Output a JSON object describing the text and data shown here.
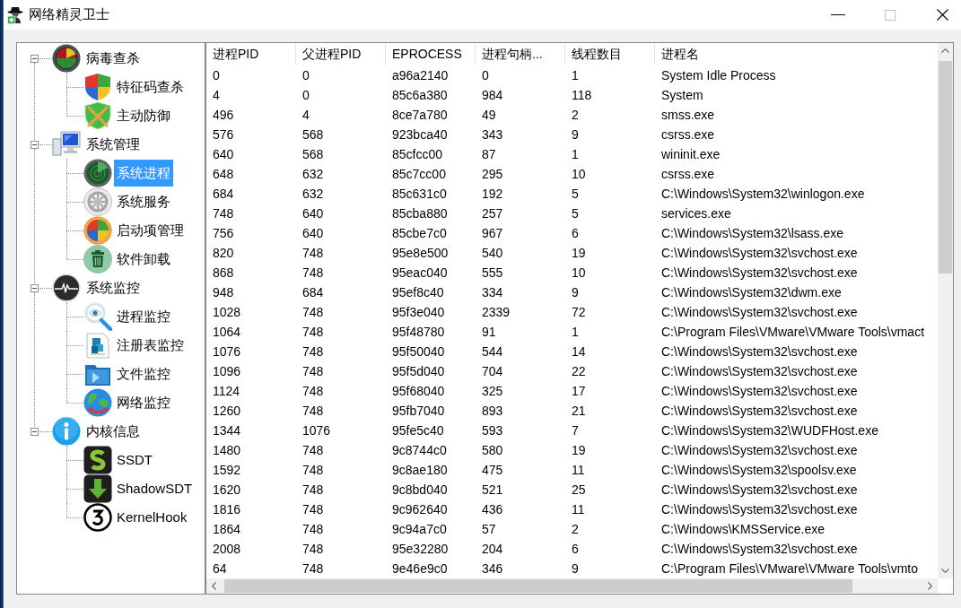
{
  "window": {
    "title": "网络精灵卫士",
    "maximize_disabled": true
  },
  "tree": [
    {
      "label": "病毒查杀",
      "expanded": true,
      "selected": false,
      "children": [
        {
          "label": "特征码查杀",
          "selected": false
        },
        {
          "label": "主动防御",
          "selected": false
        }
      ]
    },
    {
      "label": "系统管理",
      "expanded": true,
      "selected": false,
      "children": [
        {
          "label": "系统进程",
          "selected": true
        },
        {
          "label": "系统服务",
          "selected": false
        },
        {
          "label": "启动项管理",
          "selected": false
        },
        {
          "label": "软件卸载",
          "selected": false
        }
      ]
    },
    {
      "label": "系统监控",
      "expanded": true,
      "selected": false,
      "children": [
        {
          "label": "进程监控",
          "selected": false
        },
        {
          "label": "注册表监控",
          "selected": false
        },
        {
          "label": "文件监控",
          "selected": false
        },
        {
          "label": "网络监控",
          "selected": false
        }
      ]
    },
    {
      "label": "内核信息",
      "expanded": true,
      "selected": false,
      "children": [
        {
          "label": "SSDT",
          "selected": false
        },
        {
          "label": "ShadowSDT",
          "selected": false
        },
        {
          "label": "KernelHook",
          "selected": false
        }
      ]
    }
  ],
  "table": {
    "columns": [
      "进程PID",
      "父进程PID",
      "EPROCESS",
      "进程句柄...",
      "线程数目",
      "进程名"
    ],
    "rows": [
      [
        "0",
        "0",
        "a96a2140",
        "0",
        "1",
        "System Idle Process"
      ],
      [
        "4",
        "0",
        "85c6a380",
        "984",
        "118",
        "System"
      ],
      [
        "496",
        "4",
        "8ce7a780",
        "49",
        "2",
        "smss.exe"
      ],
      [
        "576",
        "568",
        "923bca40",
        "343",
        "9",
        "csrss.exe"
      ],
      [
        "640",
        "568",
        "85cfcc00",
        "87",
        "1",
        "wininit.exe"
      ],
      [
        "648",
        "632",
        "85c7cc00",
        "295",
        "10",
        "csrss.exe"
      ],
      [
        "684",
        "632",
        "85c631c0",
        "192",
        "5",
        "C:\\Windows\\System32\\winlogon.exe"
      ],
      [
        "748",
        "640",
        "85cba880",
        "257",
        "5",
        "services.exe"
      ],
      [
        "756",
        "640",
        "85cbe7c0",
        "967",
        "6",
        "C:\\Windows\\System32\\lsass.exe"
      ],
      [
        "820",
        "748",
        "95e8e500",
        "540",
        "19",
        "C:\\Windows\\System32\\svchost.exe"
      ],
      [
        "868",
        "748",
        "95eac040",
        "555",
        "10",
        "C:\\Windows\\System32\\svchost.exe"
      ],
      [
        "948",
        "684",
        "95ef8c40",
        "334",
        "9",
        "C:\\Windows\\System32\\dwm.exe"
      ],
      [
        "1028",
        "748",
        "95f3e040",
        "2339",
        "72",
        "C:\\Windows\\System32\\svchost.exe"
      ],
      [
        "1064",
        "748",
        "95f48780",
        "91",
        "1",
        "C:\\Program Files\\VMware\\VMware Tools\\vmact"
      ],
      [
        "1076",
        "748",
        "95f50040",
        "544",
        "14",
        "C:\\Windows\\System32\\svchost.exe"
      ],
      [
        "1096",
        "748",
        "95f5d040",
        "704",
        "22",
        "C:\\Windows\\System32\\svchost.exe"
      ],
      [
        "1124",
        "748",
        "95f68040",
        "325",
        "17",
        "C:\\Windows\\System32\\svchost.exe"
      ],
      [
        "1260",
        "748",
        "95fb7040",
        "893",
        "21",
        "C:\\Windows\\System32\\svchost.exe"
      ],
      [
        "1344",
        "1076",
        "95fe5c40",
        "593",
        "7",
        "C:\\Windows\\System32\\WUDFHost.exe"
      ],
      [
        "1480",
        "748",
        "9c8744c0",
        "580",
        "19",
        "C:\\Windows\\System32\\svchost.exe"
      ],
      [
        "1592",
        "748",
        "9c8ae180",
        "475",
        "11",
        "C:\\Windows\\System32\\spoolsv.exe"
      ],
      [
        "1620",
        "748",
        "9c8bd040",
        "521",
        "25",
        "C:\\Windows\\System32\\svchost.exe"
      ],
      [
        "1816",
        "748",
        "9c962640",
        "436",
        "11",
        "C:\\Windows\\System32\\svchost.exe"
      ],
      [
        "1864",
        "748",
        "9c94a7c0",
        "57",
        "2",
        "C:\\Windows\\KMSService.exe"
      ],
      [
        "2008",
        "748",
        "95e32280",
        "204",
        "6",
        "C:\\Windows\\System32\\svchost.exe"
      ],
      [
        "64",
        "748",
        "9e46e9c0",
        "346",
        "9",
        "C:\\Program Files\\VMware\\VMware Tools\\vmto"
      ]
    ]
  }
}
